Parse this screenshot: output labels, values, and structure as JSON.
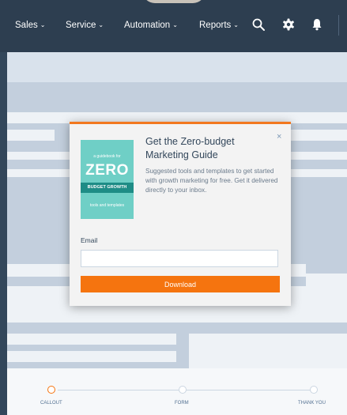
{
  "nav": {
    "items": [
      {
        "label": "Sales"
      },
      {
        "label": "Service"
      },
      {
        "label": "Automation"
      },
      {
        "label": "Reports"
      }
    ],
    "chevron": "⌄",
    "icons": [
      "search-icon",
      "gear-icon",
      "bell-icon"
    ]
  },
  "popup": {
    "cover": {
      "top_line": "a guidebook for",
      "big": "ZERO",
      "band": "BUDGET GROWTH",
      "bottom_line": "tools and templates"
    },
    "title": "Get the Zero-budget Marketing Guide",
    "body": "Suggested tools and templates to get started with growth marketing for free. Get it delivered directly to your inbox.",
    "close": "×",
    "email_label": "Email",
    "email_value": "",
    "button": "Download"
  },
  "steps": {
    "items": [
      {
        "label": "CALLOUT",
        "active": true
      },
      {
        "label": "FORM",
        "active": false
      },
      {
        "label": "THANK YOU",
        "active": false
      }
    ]
  },
  "colors": {
    "nav_bg": "#2d3e50",
    "accent": "#f5740f",
    "cover": "#6fcfc6",
    "cover_band": "#1e8c86"
  }
}
